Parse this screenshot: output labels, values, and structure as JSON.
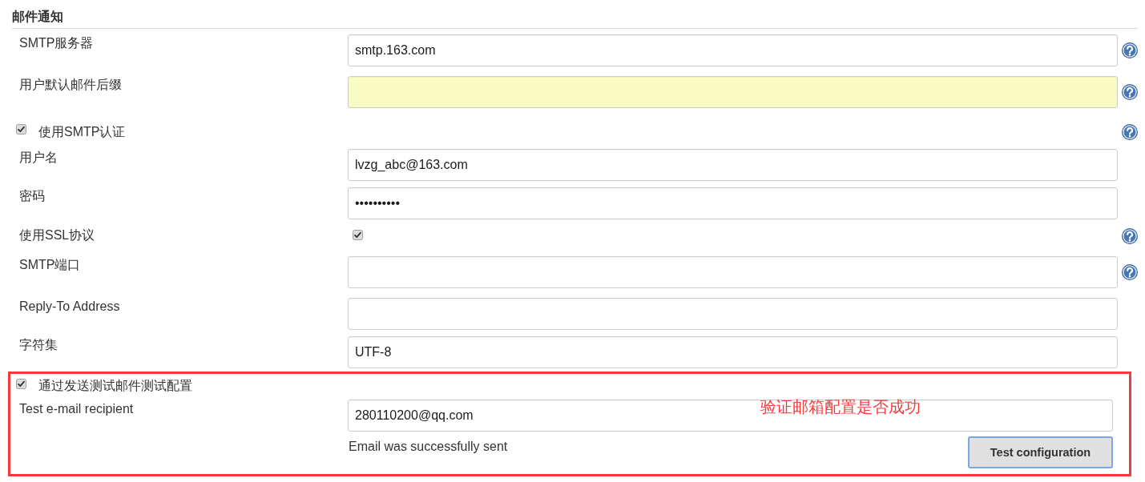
{
  "section": {
    "title": "邮件通知"
  },
  "rows": [
    {
      "kind": "text",
      "label": "SMTP服务器",
      "value": "smtp.163.com",
      "highlighted": false,
      "help": true
    },
    {
      "kind": "text",
      "label": "用户默认邮件后缀",
      "highlighted": true,
      "help": true
    },
    {
      "kind": "checkbox",
      "label": "使用SMTP认证",
      "checked": true,
      "help": true
    },
    {
      "kind": "text",
      "label": "用户名",
      "value": "lvzg_abc@163.com",
      "highlighted": false,
      "help": false
    },
    {
      "kind": "text",
      "label": "密码",
      "value": "••••••••••",
      "highlighted": false,
      "help": false
    },
    {
      "kind": "option",
      "label": "使用SSL协议",
      "checked": true,
      "help": true
    },
    {
      "kind": "text",
      "label": "SMTP端口",
      "highlighted": false,
      "help": true
    },
    {
      "kind": "text",
      "label": "Reply-To Address",
      "highlighted": false,
      "help": false
    },
    {
      "kind": "text",
      "label": "字符集",
      "value": "UTF-8",
      "highlighted": false,
      "help": false
    }
  ],
  "test_panel": {
    "checkbox": {
      "label": "通过发送测试邮件测试配置",
      "checked": true
    },
    "recipient": {
      "label": "Test e-mail recipient",
      "value": "280110200@qq.com"
    },
    "status": "Email was successfully sent",
    "button": {
      "label": "Test configuration",
      "focused": true
    },
    "annotation": "验证邮箱配置是否成功"
  }
}
